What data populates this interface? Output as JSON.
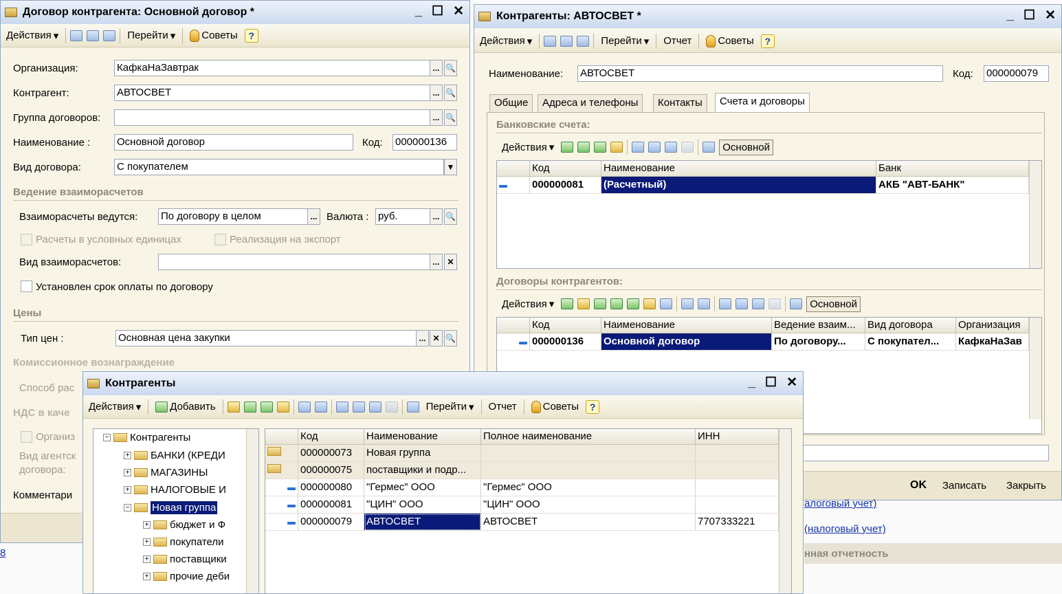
{
  "win1": {
    "title": "Договор контрагента: Основной договор *",
    "toolbar": {
      "actions": "Действия",
      "goto": "Перейти",
      "tips": "Советы",
      "help": "?"
    },
    "org_label": "Организация:",
    "org_value": "КафкаНаЗавтрак",
    "kontr_label": "Контрагент:",
    "kontr_value": "АВТОСВЕТ",
    "group_label": "Группа договоров:",
    "group_value": "",
    "name_label": "Наименование :",
    "name_value": "Основной договор",
    "code_label": "Код:",
    "code_value": "000000136",
    "type_label": "Вид договора:",
    "type_value": "С покупателем",
    "sec_mutual": "Ведение взаиморасчетов",
    "mutual_label": "Взаиморасчеты ведутся:",
    "mutual_value": "По договору в целом",
    "currency_label": "Валюта :",
    "currency_value": "руб.",
    "chk_units": "Расчеты в условных единицах",
    "chk_export": "Реализация на экспорт",
    "mutual_kind_label": "Вид взаиморасчетов:",
    "mutual_kind_value": "",
    "chk_term": "Установлен срок оплаты по договору",
    "sec_prices": "Цены",
    "price_type_label": "Тип цен :",
    "price_type_value": "Основная цена закупки",
    "sec_commission": "Комиссионное вознаграждение",
    "method_label": "Способ рас",
    "sec_vat": "НДС в каче",
    "chk_org": "Организ",
    "agent_label1": "Вид агентск",
    "agent_label2": "договора:",
    "comment_label": "Комментари",
    "left_bottom": "8"
  },
  "win2": {
    "title": "Контрагенты: АВТОСВЕТ *",
    "toolbar": {
      "actions": "Действия",
      "goto": "Перейти",
      "report": "Отчет",
      "tips": "Советы",
      "help": "?"
    },
    "name_label": "Наименование:",
    "name_value": "АВТОСВЕТ",
    "code_label": "Код:",
    "code_value": "000000079",
    "tabs": [
      "Общие",
      "Адреса и телефоны",
      "Контакты",
      "Счета и договоры"
    ],
    "sec_bank": "Банковские счета:",
    "bank_tb": {
      "actions": "Действия",
      "main": "Основной"
    },
    "bank_cols": [
      "Код",
      "Наименование",
      "Банк"
    ],
    "bank_rows": [
      {
        "code": "000000081",
        "name": "(Расчетный)",
        "bank": "АКБ \"АВТ-БАНК\""
      }
    ],
    "sec_contracts": "Договоры контрагентов:",
    "con_tb": {
      "actions": "Действия",
      "main": "Основной"
    },
    "con_cols": [
      "Код",
      "Наименование",
      "Ведение взаим...",
      "Вид договора",
      "Организация"
    ],
    "con_rows": [
      {
        "code": "000000136",
        "name": "Основной договор",
        "mutual": "По договору...",
        "type": "С покупател...",
        "org": "КафкаНаЗав"
      }
    ],
    "btn_ok": "OK",
    "btn_save": "Записать",
    "btn_close": "Закрыть",
    "link1": "алоговый учет)",
    "link2": "(налоговый учет)",
    "section_right": "нная отчетность"
  },
  "win3": {
    "title": "Контрагенты",
    "toolbar": {
      "actions": "Действия",
      "add": "Добавить",
      "goto": "Перейти",
      "report": "Отчет",
      "tips": "Советы",
      "help": "?"
    },
    "tree": [
      {
        "label": "Контрагенты",
        "level": 0,
        "sign": "−"
      },
      {
        "label": "БАНКИ (КРЕДИ",
        "level": 1,
        "sign": "+"
      },
      {
        "label": "МАГАЗИНЫ",
        "level": 1,
        "sign": "+"
      },
      {
        "label": "НАЛОГОВЫЕ И",
        "level": 1,
        "sign": "+"
      },
      {
        "label": "Новая группа",
        "level": 1,
        "sign": "−",
        "selected": true
      },
      {
        "label": "бюджет и Ф",
        "level": 2,
        "sign": "+"
      },
      {
        "label": "покупатели",
        "level": 2,
        "sign": "+"
      },
      {
        "label": "поставщики",
        "level": 2,
        "sign": "+"
      },
      {
        "label": "прочие деби",
        "level": 2,
        "sign": "+"
      }
    ],
    "cols": [
      "Код",
      "Наименование",
      "Полное наименование",
      "ИНН"
    ],
    "rows": [
      {
        "code": "000000073",
        "name": "Новая группа",
        "full": "",
        "inn": "",
        "group": true
      },
      {
        "code": "000000075",
        "name": "поставщики и подр...",
        "full": "",
        "inn": "",
        "group": true
      },
      {
        "code": "000000080",
        "name": "\"Гермес\" ООО",
        "full": "\"Гермес\" ООО",
        "inn": "",
        "group": false
      },
      {
        "code": "000000081",
        "name": "\"ЦИН\" ООО",
        "full": "\"ЦИН\" ООО",
        "inn": "",
        "group": false
      },
      {
        "code": "000000079",
        "name": "АВТОСВЕТ",
        "full": "АВТОСВЕТ",
        "inn": "7707333221",
        "group": false,
        "selected": true
      }
    ]
  }
}
